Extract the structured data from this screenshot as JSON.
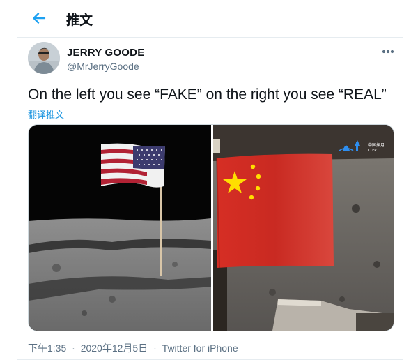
{
  "header": {
    "title": "推文"
  },
  "tweet": {
    "display_name": "JERRY GOODE",
    "handle": "@MrJerryGoode",
    "text": "On the left you see “FAKE” on the right you see “REAL”",
    "translate_label": "翻译推文",
    "time": "下午1:35",
    "date": "2020年12月5日",
    "separator": "·",
    "source": "Twitter for iPhone"
  },
  "media": {
    "watermark_label": "中国探月 CLEP"
  },
  "colors": {
    "accent": "#1da1f2",
    "secondary_text": "#5b7083",
    "border": "#e6ecf0"
  }
}
